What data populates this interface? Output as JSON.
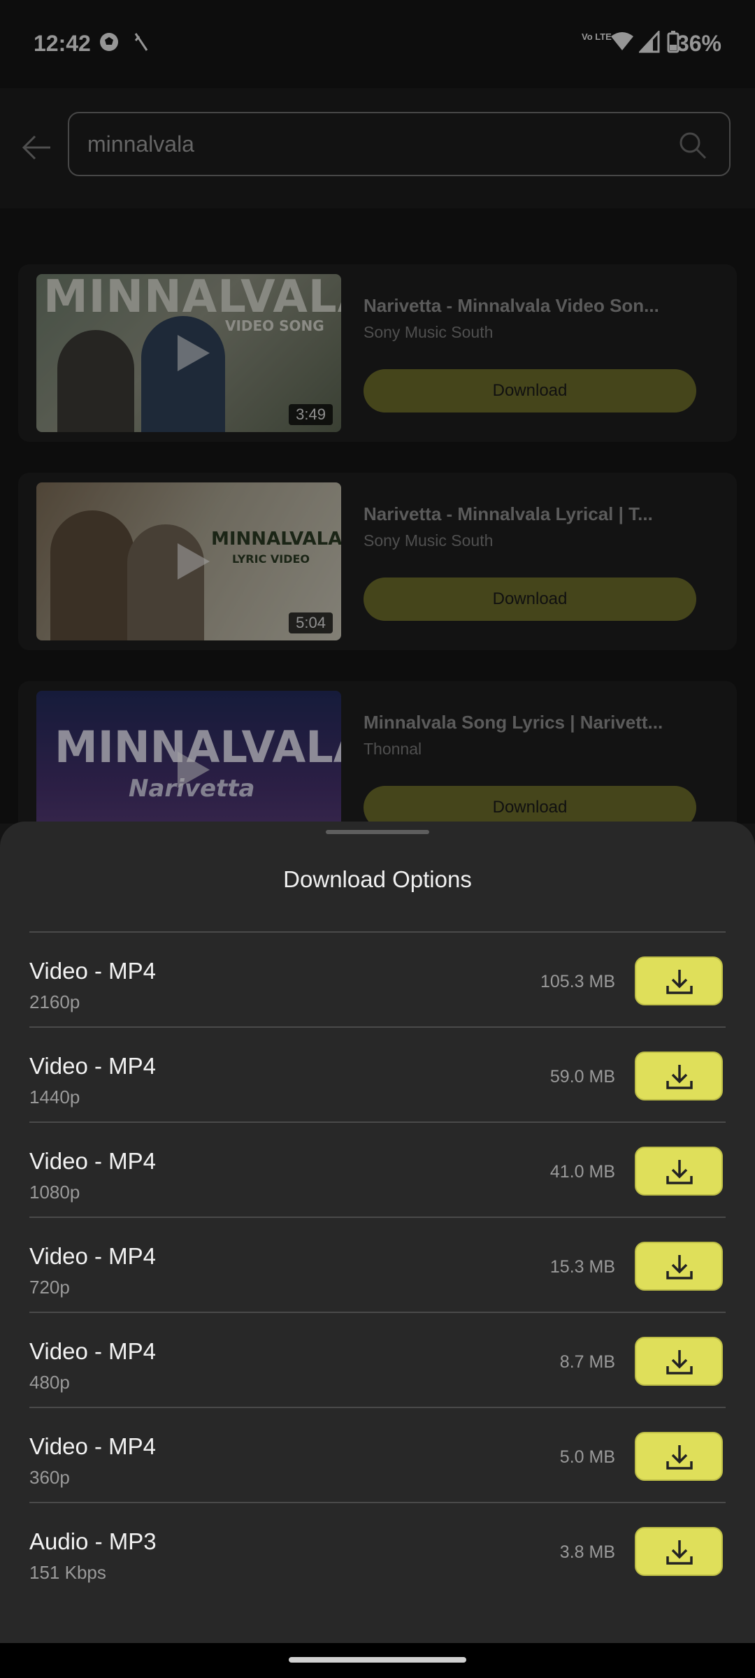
{
  "status_bar": {
    "time": "12:42",
    "battery_percent": "36%",
    "icons": [
      "soccer-ball-icon",
      "needle-icon",
      "volte-icon",
      "wifi-icon",
      "signal-icon",
      "battery-icon"
    ],
    "volte_label": "Vo LTE"
  },
  "search": {
    "query": "minnalvala",
    "back_icon": "arrow-left-icon",
    "search_icon": "search-icon"
  },
  "results": [
    {
      "title": "Narivetta - Minnalvala Video Son...",
      "channel": "Sony Music South",
      "duration": "3:49",
      "download_label": "Download",
      "thumb_text": "MINNALVALA",
      "thumb_sub": "VIDEO SONG"
    },
    {
      "title": "Narivetta - Minnalvala Lyrical | T...",
      "channel": "Sony Music South",
      "duration": "5:04",
      "download_label": "Download",
      "thumb_text": "MINNALVALA",
      "thumb_sub": "LYRIC VIDEO"
    },
    {
      "title": "Minnalvala Song Lyrics | Narivett...",
      "channel": "Thonnal",
      "duration": "",
      "download_label": "Download",
      "thumb_text": "MINNALVALA",
      "thumb_sub": "Narivetta"
    }
  ],
  "sheet": {
    "title": "Download Options",
    "options": [
      {
        "name": "Video - MP4",
        "quality": "2160p",
        "size": "105.3 MB"
      },
      {
        "name": "Video - MP4",
        "quality": "1440p",
        "size": "59.0 MB"
      },
      {
        "name": "Video - MP4",
        "quality": "1080p",
        "size": "41.0 MB"
      },
      {
        "name": "Video - MP4",
        "quality": "720p",
        "size": "15.3 MB"
      },
      {
        "name": "Video - MP4",
        "quality": "480p",
        "size": "8.7 MB"
      },
      {
        "name": "Video - MP4",
        "quality": "360p",
        "size": "5.0 MB"
      },
      {
        "name": "Audio - MP3",
        "quality": "151 Kbps",
        "size": "3.8 MB"
      }
    ]
  },
  "colors": {
    "accent": "#dfdf5a",
    "dim_button": "#6b6a2a",
    "sheet_bg": "#282828",
    "page_bg": "#141414"
  }
}
